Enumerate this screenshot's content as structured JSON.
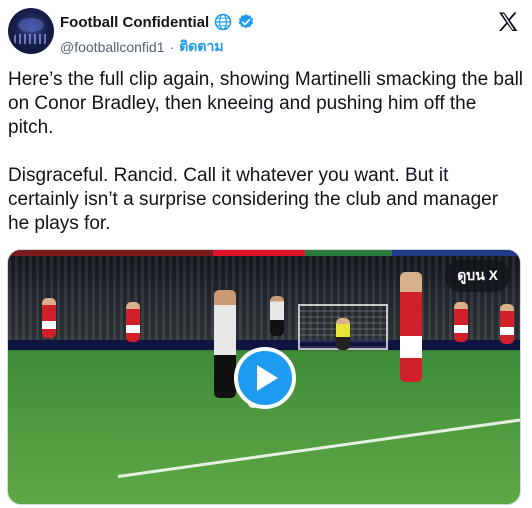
{
  "author": {
    "name": "Football Confidential",
    "handle": "@footballconfid1",
    "separator": "·",
    "follow_label": "ติดตาม"
  },
  "icons": {
    "globe": "globe-icon",
    "verified": "verified-badge-icon",
    "brand": "x-logo-icon",
    "play": "play-icon"
  },
  "tweet": {
    "paragraphs": [
      "Here’s the full clip again, showing Martinelli smacking the ball on Conor Bradley, then kneeing and pushing him off the pitch.",
      "Disgraceful. Rancid. Call it whatever you want. But it certainly isn’t a surprise considering the club and manager he plays for."
    ]
  },
  "media": {
    "dub_label": "ดูบน X"
  },
  "colors": {
    "accent": "#1d9bf0",
    "text": "#0f1419",
    "secondary": "#536471"
  }
}
